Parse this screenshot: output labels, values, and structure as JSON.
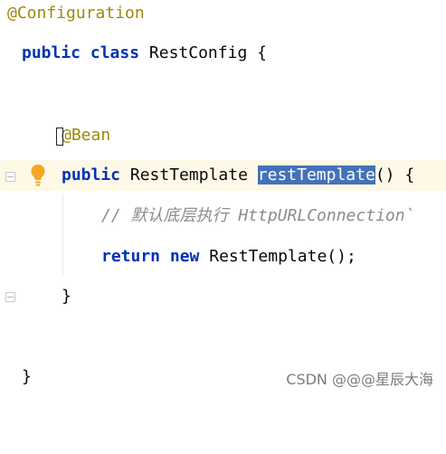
{
  "code_lines": {
    "l1": {
      "annotation": "@Configuration"
    },
    "l2": {
      "kw_public": "public",
      "kw_class": "class",
      "class_name": "RestConfig",
      "brace": "{"
    },
    "l3": {
      "annotation": "@Bean"
    },
    "l4": {
      "kw_public": "public",
      "return_type": "RestTemplate",
      "method_name": "restTemplate",
      "signature_rest": "() {"
    },
    "l5": {
      "comment": "// 默认底层执行 HttpURLConnection`"
    },
    "l6": {
      "kw_return": "return",
      "kw_new": "new",
      "call": "RestTemplate();"
    },
    "l7": {
      "brace": "}"
    },
    "l8": {
      "brace": "}"
    }
  },
  "icons": {
    "bulb": "lightbulb-icon",
    "fold": "fold-marker-icon",
    "cursor": "text-cursor-icon"
  },
  "colors": {
    "annotation": "#9e880d",
    "keyword": "#0033b3",
    "comment": "#8c8c8c",
    "selection": "#4472b8",
    "current_line": "#fdf9e6",
    "bulb": "#f5a623"
  },
  "watermark": {
    "text": "CSDN @@@星辰大海"
  }
}
